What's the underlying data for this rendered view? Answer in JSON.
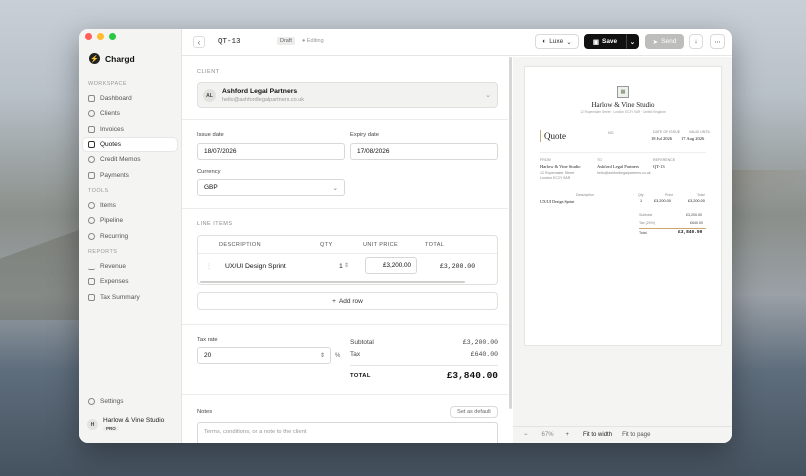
{
  "app": {
    "name": "Chargd"
  },
  "sidebar": {
    "sections": {
      "workspace": "WORKSPACE",
      "tools": "TOOLS",
      "reports": "REPORTS"
    },
    "workspace": [
      "Dashboard",
      "Clients",
      "Invoices",
      "Quotes",
      "Credit Memos",
      "Payments"
    ],
    "tools": [
      "Items",
      "Pipeline",
      "Recurring"
    ],
    "reports": [
      "Revenue",
      "Expenses",
      "Tax Summary"
    ],
    "settings": "Settings",
    "user": {
      "initial": "H",
      "name": "Harlow & Vine Studio",
      "plan": "PRO"
    }
  },
  "toolbar": {
    "doc_id": "QT-13",
    "status": "Draft",
    "saving_state": "Editing",
    "theme": "Luxe",
    "save": "Save",
    "send": "Send"
  },
  "form": {
    "client_label": "CLIENT",
    "client": {
      "initials": "AL",
      "name": "Ashford Legal Partners",
      "email": "hello@ashfordlegalpartners.co.uk"
    },
    "issue_label": "Issue date",
    "issue": "18/07/2026",
    "expiry_label": "Expiry date",
    "expiry": "17/08/2026",
    "currency_label": "Currency",
    "currency": "GBP",
    "line_items_label": "LINE ITEMS",
    "cols": {
      "description": "DESCRIPTION",
      "qty": "QTY",
      "unit": "UNIT PRICE",
      "total": "TOTAL"
    },
    "item": {
      "description": "UX/UI Design Sprint",
      "qty": "1",
      "unit": "£3,200.00",
      "total": "£3,200.00"
    },
    "add_row": "Add row",
    "tax_label": "Tax rate",
    "tax": "20",
    "pct": "%",
    "subtotal_label": "Subtotal",
    "subtotal": "£3,200.00",
    "tax_amount_label": "Tax",
    "tax_amount": "£640.00",
    "total_label": "TOTAL",
    "total": "£3,840.00",
    "notes_label": "Notes",
    "set_default": "Set as default",
    "notes_placeholder": "Terms, conditions, or a note to the client"
  },
  "preview": {
    "studio": "Harlow & Vine Studio",
    "address": "12 Ropemaker Street · London EC2Y 9AR · United Kingdom",
    "title": "Quote",
    "no_label": "NO.",
    "no": "QT-13",
    "date_label": "DATE OF ISSUE",
    "date": "18 Jul 2026",
    "valid_label": "VALID UNTIL",
    "valid": "17 Aug 2026",
    "from_label": "FROM",
    "from_name": "Harlow & Vine Studio",
    "from_addr1": "12 Ropemaker Street",
    "from_addr2": "London EC2Y 9AR",
    "to_label": "TO",
    "to_name": "Ashford Legal Partners",
    "to_mail": "hello@ashfordlegalpartners.co.uk",
    "ref_label": "REFERENCE",
    "ref": "QT-13",
    "cols": {
      "desc": "Description",
      "qty": "Qty",
      "price": "Price",
      "total": "Total"
    },
    "line": {
      "desc": "UX/UI Design Sprint",
      "qty": "1",
      "price": "£3,200.00",
      "total": "£3,200.00"
    },
    "subtotal_label": "Subtotal",
    "subtotal": "£3,200.00",
    "tax_label": "Tax (20%)",
    "tax": "£640.00",
    "total_label": "Total",
    "total": "£3,840.00"
  },
  "zoom": {
    "minus": "−",
    "level": "67%",
    "plus": "+",
    "fit_width": "Fit to width",
    "fit_page": "Fit to page"
  }
}
